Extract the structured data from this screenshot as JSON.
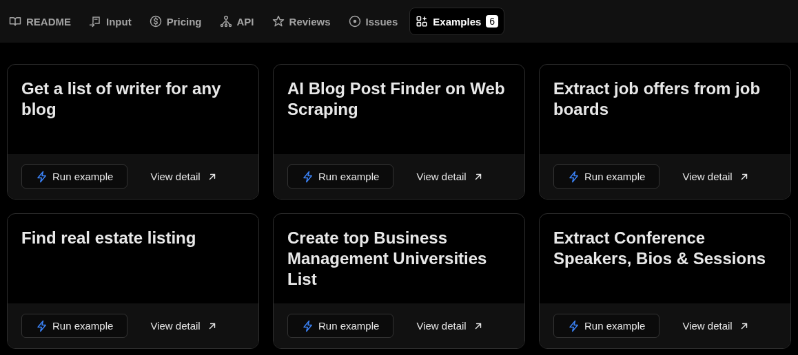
{
  "tabs": [
    {
      "kind": "book",
      "label": "README",
      "selected": false
    },
    {
      "kind": "input",
      "label": "Input",
      "selected": false
    },
    {
      "kind": "dollar",
      "label": "Pricing",
      "selected": false
    },
    {
      "kind": "api",
      "label": "API",
      "selected": false
    },
    {
      "kind": "star",
      "label": "Reviews",
      "selected": false
    },
    {
      "kind": "issue",
      "label": "Issues",
      "selected": false
    },
    {
      "kind": "grid",
      "label": "Examples",
      "selected": true,
      "count": "6"
    }
  ],
  "examples": [
    {
      "title": "Get a list of writer for any blog",
      "run": "Run example",
      "detail": "View detail"
    },
    {
      "title": "AI Blog Post Finder on Web Scraping",
      "run": "Run example",
      "detail": "View detail"
    },
    {
      "title": "Extract job offers from job boards",
      "run": "Run example",
      "detail": "View detail"
    },
    {
      "title": "Find real estate listing",
      "run": "Run example",
      "detail": "View detail"
    },
    {
      "title": "Create top Business Management Universities List",
      "run": "Run example",
      "detail": "View detail"
    },
    {
      "title": "Extract Conference Speakers, Bios & Sessions",
      "run": "Run example",
      "detail": "View detail"
    }
  ]
}
